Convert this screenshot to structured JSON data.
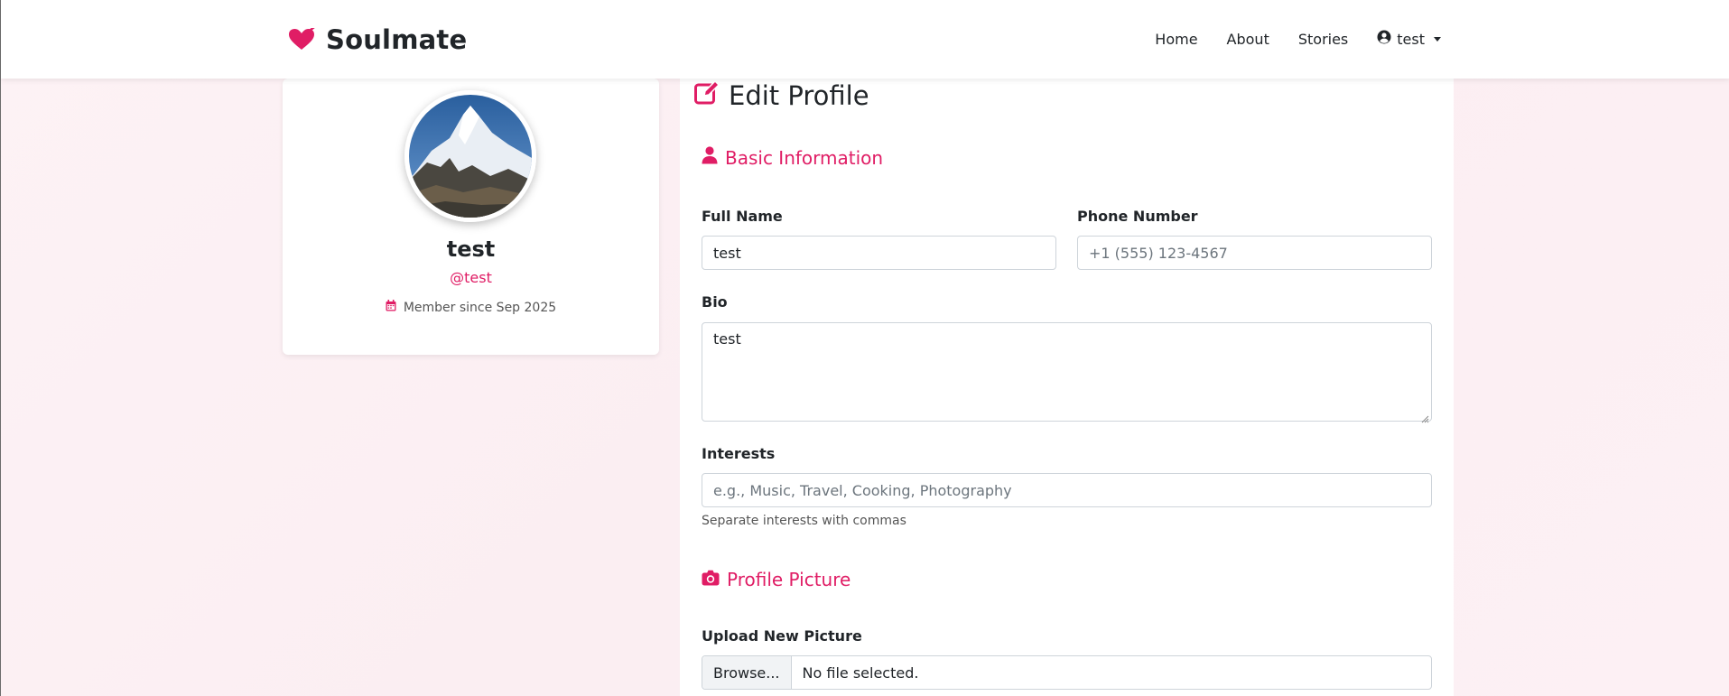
{
  "brand": {
    "name": "Soulmate",
    "icon": "heart-arrow-icon",
    "accent_color": "#e01d65"
  },
  "nav": {
    "links": [
      "Home",
      "About",
      "Stories"
    ],
    "user_label": "test",
    "user_icon": "user-circle-icon"
  },
  "profile": {
    "name": "test",
    "handle": "@test",
    "member_since": "Member since Sep 2025",
    "avatar_icon": "mountain-photo"
  },
  "edit": {
    "title": "Edit Profile",
    "basic_section": "Basic Information",
    "full_name_label": "Full Name",
    "full_name_value": "test",
    "phone_label": "Phone Number",
    "phone_placeholder": "+1 (555) 123-4567",
    "bio_label": "Bio",
    "bio_value": "test",
    "interests_label": "Interests",
    "interests_placeholder": "e.g., Music, Travel, Cooking, Photography",
    "interests_help": "Separate interests with commas",
    "picture_section": "Profile Picture",
    "upload_label": "Upload New Picture",
    "browse_label": "Browse...",
    "file_status": "No file selected."
  }
}
